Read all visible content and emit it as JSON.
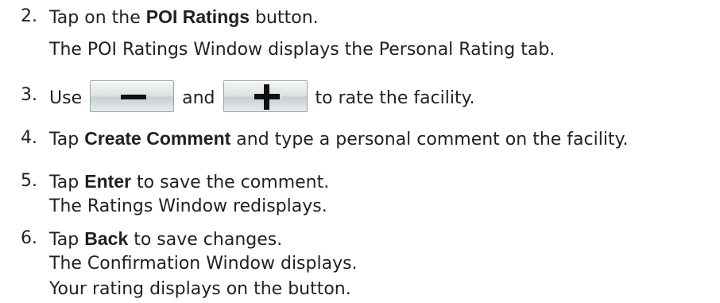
{
  "steps": [
    {
      "number": "2.",
      "line1": {
        "pre": "Tap on the ",
        "bold": "POI Ratings",
        "post": " button."
      },
      "line2": "The POI Ratings Window displays the Personal Rating tab."
    },
    {
      "number": "3.",
      "pre": "Use",
      "mid": "and",
      "post": "to rate the facility.",
      "minus_icon": "minus-icon",
      "plus_icon": "plus-icon"
    },
    {
      "number": "4.",
      "pre": "Tap ",
      "bold": "Create Comment",
      "post": " and type a personal comment on the facility."
    },
    {
      "number": "5.",
      "line1": {
        "pre": "Tap ",
        "bold": "Enter",
        "post": " to save the comment."
      },
      "line2": "The Ratings Window redisplays."
    },
    {
      "number": "6.",
      "line1": {
        "pre": "Tap ",
        "bold": "Back",
        "post": " to save changes."
      },
      "line2": "The Confirmation Window displays.",
      "line3": "Your rating displays on the button."
    }
  ]
}
